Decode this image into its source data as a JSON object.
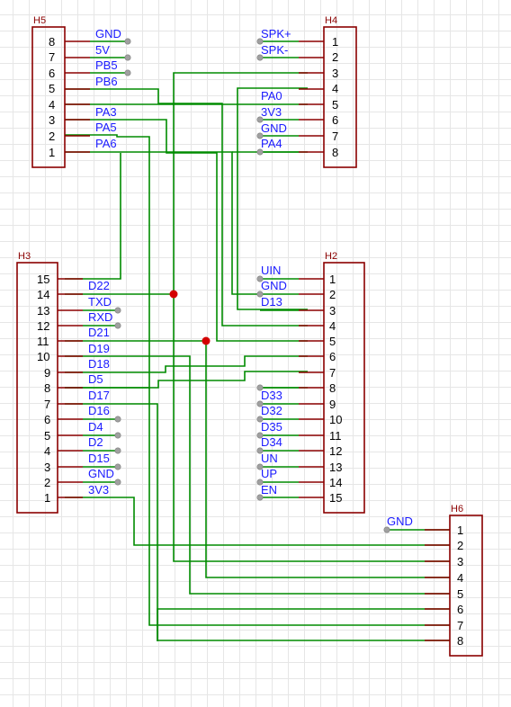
{
  "components": {
    "H5": {
      "ref": "H5",
      "pins": [
        {
          "num": "8",
          "net": "GND"
        },
        {
          "num": "7",
          "net": "5V"
        },
        {
          "num": "6",
          "net": "PB5"
        },
        {
          "num": "5",
          "net": "PB6"
        },
        {
          "num": "4",
          "net": ""
        },
        {
          "num": "3",
          "net": "PA3"
        },
        {
          "num": "2",
          "net": "PA5"
        },
        {
          "num": "1",
          "net": "PA6"
        }
      ]
    },
    "H4": {
      "ref": "H4",
      "pins": [
        {
          "num": "1",
          "net": "SPK+"
        },
        {
          "num": "2",
          "net": "SPK-"
        },
        {
          "num": "3",
          "net": ""
        },
        {
          "num": "4",
          "net": "PA0"
        },
        {
          "num": "5",
          "net": "3V3"
        },
        {
          "num": "6",
          "net": "GND"
        },
        {
          "num": "7",
          "net": "PA4"
        },
        {
          "num": "8",
          "net": ""
        }
      ]
    },
    "H3": {
      "ref": "H3",
      "pins": [
        {
          "num": "15",
          "net": "D22"
        },
        {
          "num": "14",
          "net": "TXD"
        },
        {
          "num": "13",
          "net": "RXD"
        },
        {
          "num": "12",
          "net": "D21"
        },
        {
          "num": "11",
          "net": "D19"
        },
        {
          "num": "10",
          "net": "D18"
        },
        {
          "num": "9",
          "net": "D5"
        },
        {
          "num": "8",
          "net": "D17"
        },
        {
          "num": "7",
          "net": "D16"
        },
        {
          "num": "6",
          "net": "D4"
        },
        {
          "num": "5",
          "net": "D2"
        },
        {
          "num": "4",
          "net": "D15"
        },
        {
          "num": "3",
          "net": "GND"
        },
        {
          "num": "2",
          "net": "3V3"
        },
        {
          "num": "1",
          "net": ""
        }
      ]
    },
    "H2": {
      "ref": "H2",
      "pins": [
        {
          "num": "1",
          "net": "UIN"
        },
        {
          "num": "2",
          "net": "GND"
        },
        {
          "num": "3",
          "net": "D13"
        },
        {
          "num": "4",
          "net": ""
        },
        {
          "num": "5",
          "net": ""
        },
        {
          "num": "6",
          "net": ""
        },
        {
          "num": "7",
          "net": ""
        },
        {
          "num": "8",
          "net": "D33"
        },
        {
          "num": "9",
          "net": "D32"
        },
        {
          "num": "10",
          "net": "D35"
        },
        {
          "num": "11",
          "net": "D34"
        },
        {
          "num": "12",
          "net": "UN"
        },
        {
          "num": "13",
          "net": "UP"
        },
        {
          "num": "14",
          "net": "EN"
        },
        {
          "num": "15",
          "net": ""
        }
      ]
    },
    "H6": {
      "ref": "H6",
      "pins": [
        {
          "num": "1",
          "net": "GND"
        },
        {
          "num": "2",
          "net": ""
        },
        {
          "num": "3",
          "net": ""
        },
        {
          "num": "4",
          "net": ""
        },
        {
          "num": "5",
          "net": ""
        },
        {
          "num": "6",
          "net": ""
        },
        {
          "num": "7",
          "net": ""
        },
        {
          "num": "8",
          "net": ""
        }
      ]
    }
  },
  "colors": {
    "component": "#8b0000",
    "wire": "#008c00",
    "net_label": "#1a1aff",
    "junction": "#d40000",
    "grid": "#e6e6e6"
  }
}
